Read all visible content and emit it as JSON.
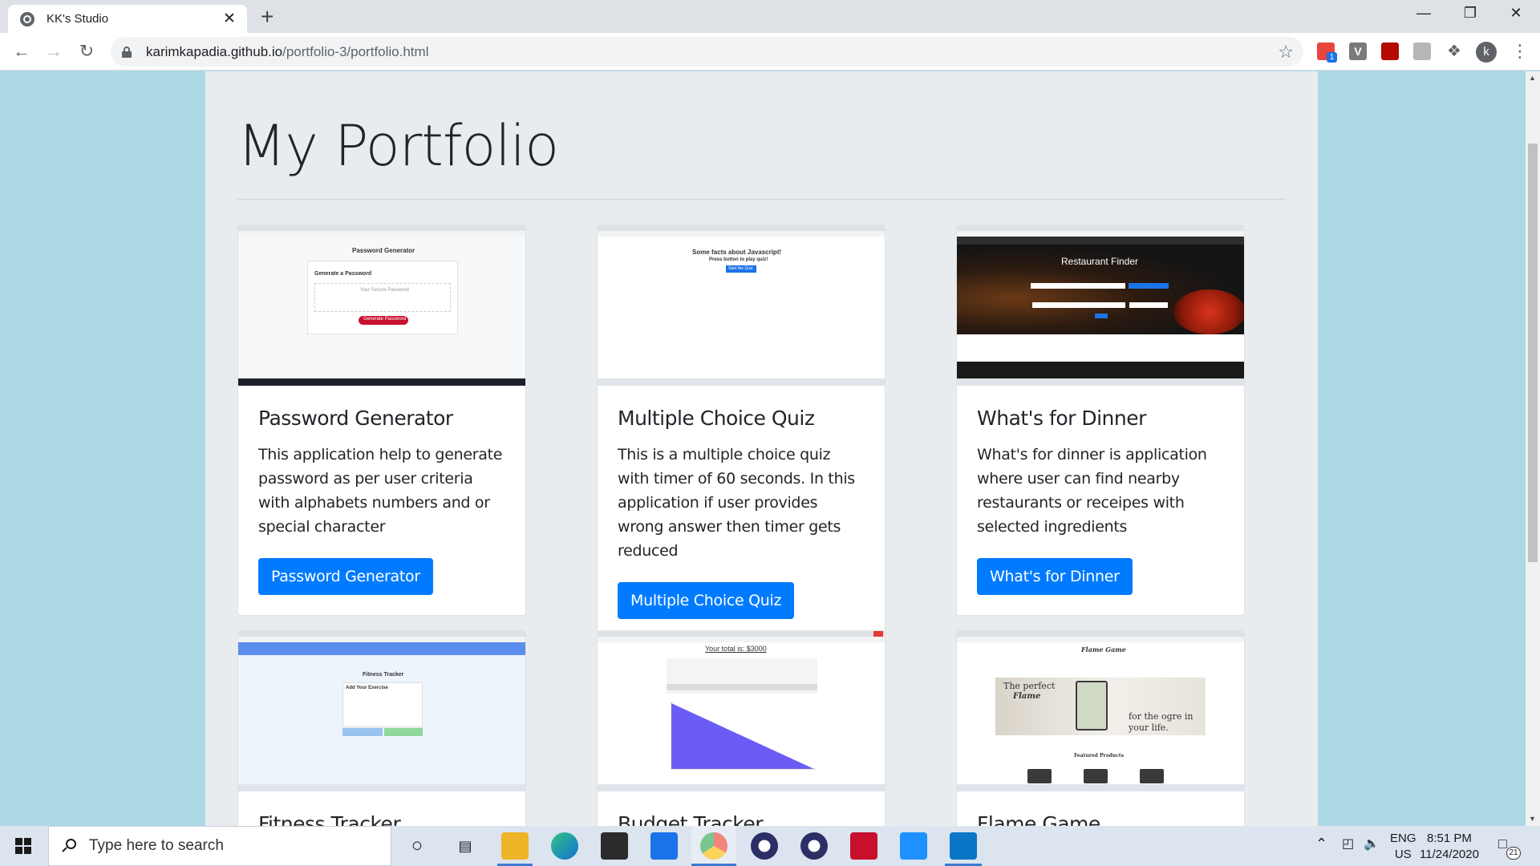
{
  "browser": {
    "tab_title": "KK's Studio",
    "tab_close": "✕",
    "new_tab": "+",
    "url_host": "karimkapadia.github.io",
    "url_path": "/portfolio-3/portfolio.html",
    "window_controls": {
      "minimize": "—",
      "restore": "❐",
      "close": "✕"
    },
    "extensions": [
      "tag-icon",
      "v-icon",
      "acrobat-icon",
      "puzzle-icon",
      "extensions-icon"
    ],
    "extension_badge": "1",
    "extension_v": "V",
    "profile_initial": "k"
  },
  "page": {
    "title": "My Portfolio",
    "cards": [
      {
        "title": "Password Generator",
        "description": "This application help to generate password as per user criteria with alphabets numbers and or special character",
        "button": "Password Generator",
        "thumb": {
          "heading": "Password Generator",
          "sub": "Generate a Password",
          "placeholder": "Your Secure Password",
          "btn": "Generate Password"
        }
      },
      {
        "title": "Multiple Choice Quiz",
        "description": "This is a multiple choice quiz with timer of 60 seconds. In this application if user provides wrong answer then timer gets reduced",
        "button": "Multiple Choice Quiz",
        "thumb": {
          "heading": "Some facts about Javascript!",
          "sub": "Press button to play quiz!",
          "btn": "Start the Quiz"
        }
      },
      {
        "title": "What's for Dinner",
        "description": "What's for dinner is application where user can find nearby restaurants or receipes with selected ingredients",
        "button": "What's for Dinner",
        "thumb": {
          "heading": "Restaurant Finder"
        }
      },
      {
        "title": "Fitness Tracker",
        "thumb": {
          "heading": "Fitness Tracker",
          "sub": "Add Your Exercise"
        }
      },
      {
        "title": "Budget Tracker",
        "thumb": {
          "heading": "Your total is: $3000"
        }
      },
      {
        "title": "Flame Game",
        "thumb": {
          "heading": "Flame Game",
          "line1": "The perfect",
          "line2": "Flame",
          "line3": "for the ogre in",
          "line4": "your life.",
          "sub": "Featured Products"
        }
      }
    ]
  },
  "taskbar": {
    "search_placeholder": "Type here to search",
    "lang_line1": "ENG",
    "lang_line2": "US",
    "time": "8:51 PM",
    "date": "11/24/2020",
    "notifications": "21"
  },
  "colors": {
    "page_bg": "#add8e6",
    "container_bg": "#e9ecef",
    "button_primary": "#007bff"
  }
}
